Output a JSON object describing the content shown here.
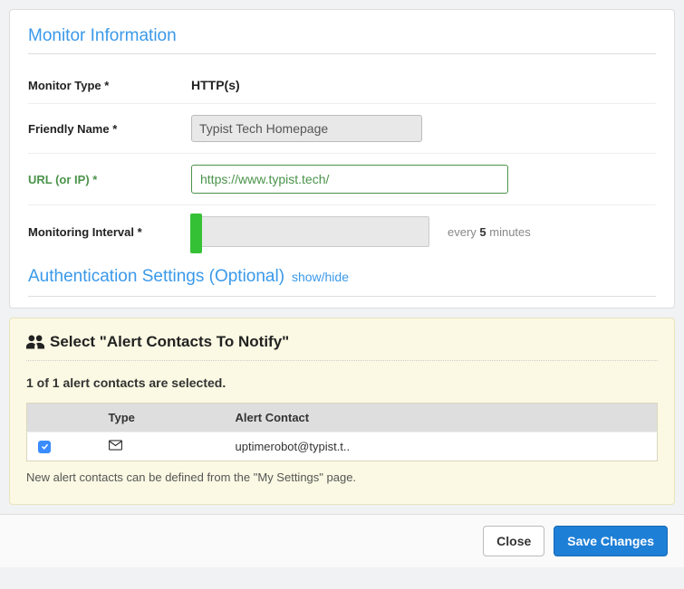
{
  "monitor_info": {
    "title": "Monitor Information",
    "monitor_type_label": "Monitor Type *",
    "monitor_type_value": "HTTP(s)",
    "friendly_name_label": "Friendly Name *",
    "friendly_name_value": "Typist Tech Homepage",
    "url_label": "URL (or IP) *",
    "url_value": "https://www.typist.tech/",
    "interval_label": "Monitoring Interval *",
    "interval_prefix": "every ",
    "interval_value": "5",
    "interval_suffix": " minutes"
  },
  "auth": {
    "title": "Authentication Settings (Optional)",
    "toggle": "show/hide"
  },
  "alerts": {
    "header": "Select \"Alert Contacts To Notify\"",
    "selected_text": "1 of 1 alert contacts are selected.",
    "col_type": "Type",
    "col_contact": "Alert Contact",
    "rows": [
      {
        "checked": true,
        "type_icon": "envelope",
        "contact": "uptimerobot@typist.t.."
      }
    ],
    "hint": "New alert contacts can be defined from the \"My Settings\" page."
  },
  "footer": {
    "close": "Close",
    "save": "Save Changes"
  }
}
